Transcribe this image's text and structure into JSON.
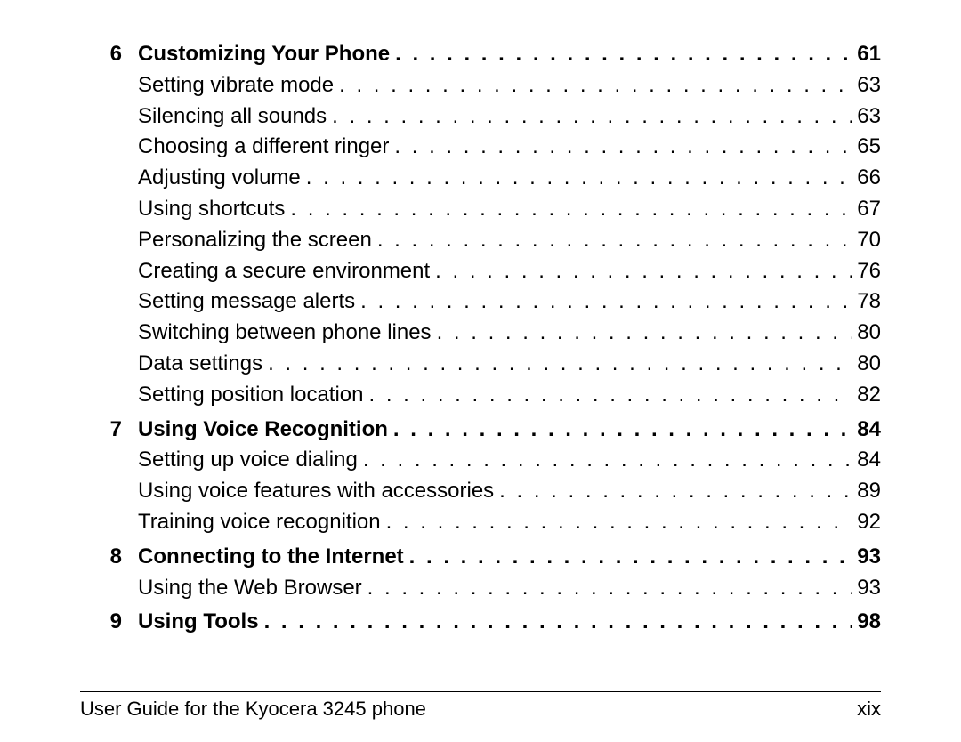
{
  "toc": [
    {
      "type": "chapter",
      "num": "6",
      "title": "Customizing Your Phone",
      "page": "61"
    },
    {
      "type": "section",
      "title": "Setting vibrate mode",
      "page": "63"
    },
    {
      "type": "section",
      "title": "Silencing all sounds",
      "page": "63"
    },
    {
      "type": "section",
      "title": "Choosing a different ringer",
      "page": "65"
    },
    {
      "type": "section",
      "title": "Adjusting volume",
      "page": "66"
    },
    {
      "type": "section",
      "title": "Using shortcuts",
      "page": "67"
    },
    {
      "type": "section",
      "title": "Personalizing the screen",
      "page": "70"
    },
    {
      "type": "section",
      "title": "Creating a secure environment",
      "page": "76"
    },
    {
      "type": "section",
      "title": "Setting message alerts",
      "page": "78"
    },
    {
      "type": "section",
      "title": "Switching between phone lines",
      "page": "80"
    },
    {
      "type": "section",
      "title": "Data settings",
      "page": "80"
    },
    {
      "type": "section",
      "title": "Setting position location",
      "page": "82"
    },
    {
      "type": "chapter",
      "num": "7",
      "title": "Using Voice Recognition",
      "page": "84"
    },
    {
      "type": "section",
      "title": "Setting up voice dialing",
      "page": "84"
    },
    {
      "type": "section",
      "title": "Using voice features with accessories",
      "page": "89"
    },
    {
      "type": "section",
      "title": "Training voice recognition",
      "page": "92"
    },
    {
      "type": "chapter",
      "num": "8",
      "title": "Connecting to the Internet",
      "page": "93"
    },
    {
      "type": "section",
      "title": "Using the Web Browser",
      "page": "93"
    },
    {
      "type": "chapter",
      "num": "9",
      "title": "Using Tools",
      "page": "98"
    }
  ],
  "footer": {
    "left": "User Guide for the Kyocera 3245 phone",
    "right": "xix"
  }
}
